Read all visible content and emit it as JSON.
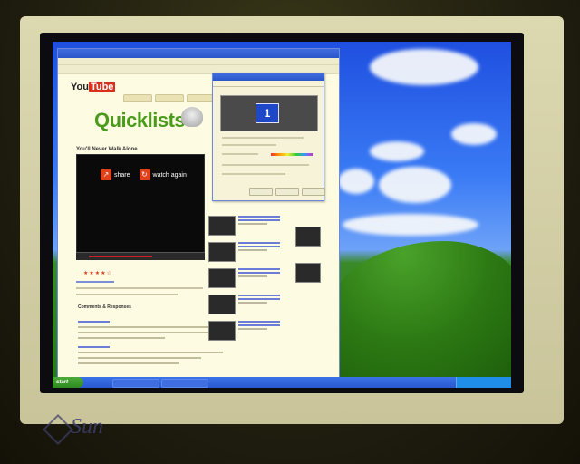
{
  "monitor": {
    "brand": "Sun"
  },
  "browser": {
    "site_logo_you": "You",
    "site_logo_tube": "Tube",
    "page_heading": "Quicklists",
    "video_title": "You'll Never Walk Alone",
    "player": {
      "share_label": "share",
      "watch_again_label": "watch again"
    },
    "comments_heading": "Comments & Responses"
  },
  "display_dialog": {
    "monitor_number": "1"
  },
  "taskbar": {
    "start_label": "start"
  }
}
